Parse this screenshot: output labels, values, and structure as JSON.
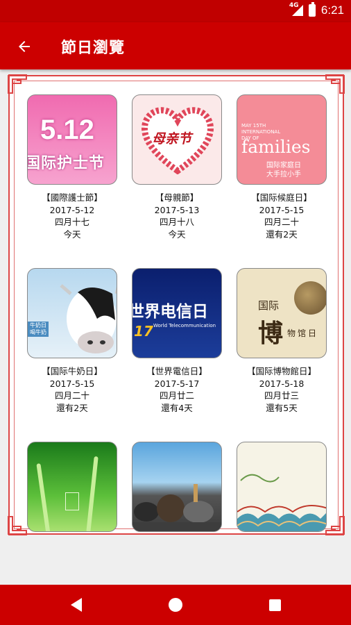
{
  "status": {
    "network": "4G",
    "time": "6:21"
  },
  "appbar": {
    "title": "節日瀏覽"
  },
  "festivals": [
    {
      "name": "【國際護士節】",
      "date": "2017-5-12",
      "lunar": "四月十七",
      "countdown": "今天",
      "thumb_big": "5.12",
      "thumb_sub": "国际护士节"
    },
    {
      "name": "【母親節】",
      "date": "2017-5-13",
      "lunar": "四月十八",
      "countdown": "今天",
      "thumb_text": "母亲节"
    },
    {
      "name": "【国际候庭日】",
      "date": "2017-5-15",
      "lunar": "四月二十",
      "countdown": "還有2天",
      "thumb_en1": "MAY 15TH",
      "thumb_en2": "INTERNATIONAL",
      "thumb_en3": "DAY OF",
      "thumb_en4": "families",
      "thumb_cn1": "国际家庭日",
      "thumb_cn2": "大手拉小手"
    },
    {
      "name": "【国际牛奶日】",
      "date": "2017-5-15",
      "lunar": "四月二十",
      "countdown": "還有2天",
      "thumb_tag1": "牛奶日",
      "thumb_tag2": "喝牛奶"
    },
    {
      "name": "【世界電信日】",
      "date": "2017-5-17",
      "lunar": "四月廿二",
      "countdown": "還有4天",
      "thumb_cn": "世界电信日",
      "thumb_en": "World Telecommunication",
      "thumb_num": "17"
    },
    {
      "name": "【国际博物館日】",
      "date": "2017-5-18",
      "lunar": "四月廿三",
      "countdown": "還有5天",
      "thumb_a": "国际",
      "thumb_b": "博",
      "thumb_c": "物馆日"
    },
    {
      "name": "",
      "date": "",
      "lunar": "",
      "countdown": ""
    },
    {
      "name": "",
      "date": "",
      "lunar": "",
      "countdown": ""
    },
    {
      "name": "",
      "date": "",
      "lunar": "",
      "countdown": ""
    }
  ],
  "colors": {
    "primary": "#cc0000",
    "status": "#c00000",
    "frame": "#dd4444"
  },
  "nav": {
    "back": "back-icon",
    "home": "home-icon",
    "recent": "recent-apps-icon"
  }
}
